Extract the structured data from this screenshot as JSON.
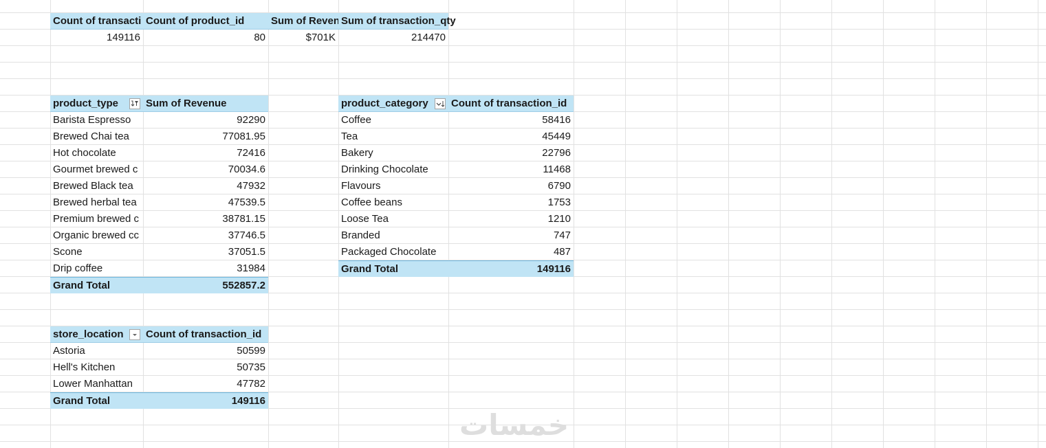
{
  "summary": {
    "headers": [
      "Count of transacti",
      "Count of product_id",
      "Sum of Reven",
      "Sum of transaction_qty"
    ],
    "values": [
      "149116",
      "80",
      "$701K",
      "214470"
    ]
  },
  "product_type_table": {
    "header_label": "product_type",
    "value_header": "Sum of Revenue",
    "rows": [
      {
        "label": "Barista Espresso",
        "value": "92290"
      },
      {
        "label": "Brewed Chai tea",
        "value": "77081.95"
      },
      {
        "label": "Hot chocolate",
        "value": "72416"
      },
      {
        "label": "Gourmet brewed c",
        "value": "70034.6"
      },
      {
        "label": "Brewed Black tea",
        "value": "47932"
      },
      {
        "label": "Brewed herbal tea",
        "value": "47539.5"
      },
      {
        "label": "Premium brewed c",
        "value": "38781.15"
      },
      {
        "label": "Organic brewed cc",
        "value": "37746.5"
      },
      {
        "label": "Scone",
        "value": "37051.5"
      },
      {
        "label": "Drip coffee",
        "value": "31984"
      }
    ],
    "total_label": "Grand Total",
    "total_value": "552857.2"
  },
  "product_category_table": {
    "header_label": "product_category",
    "value_header": "Count of transaction_id",
    "rows": [
      {
        "label": "Coffee",
        "value": "58416"
      },
      {
        "label": "Tea",
        "value": "45449"
      },
      {
        "label": "Bakery",
        "value": "22796"
      },
      {
        "label": "Drinking Chocolate",
        "value": "11468"
      },
      {
        "label": "Flavours",
        "value": "6790"
      },
      {
        "label": "Coffee beans",
        "value": "1753"
      },
      {
        "label": "Loose Tea",
        "value": "1210"
      },
      {
        "label": "Branded",
        "value": "747"
      },
      {
        "label": "Packaged Chocolate",
        "value": "487"
      }
    ],
    "total_label": "Grand Total",
    "total_value": "149116"
  },
  "store_location_table": {
    "header_label": "store_location",
    "value_header": "Count of transaction_id",
    "rows": [
      {
        "label": "Astoria",
        "value": "50599"
      },
      {
        "label": "Hell's Kitchen",
        "value": "50735"
      },
      {
        "label": "Lower Manhattan",
        "value": "47782"
      }
    ],
    "total_label": "Grand Total",
    "total_value": "149116"
  },
  "icons": {
    "product_type_filter": "filter-sort-icon",
    "product_category_filter": "sort-descending-icon",
    "store_location_filter": "dropdown-arrow-icon"
  },
  "watermark": "خمسات",
  "colors": {
    "pivot_header_bg": "#c0e4f5",
    "gridline": "#e1e1e1",
    "total_border": "#6cb5dc"
  }
}
